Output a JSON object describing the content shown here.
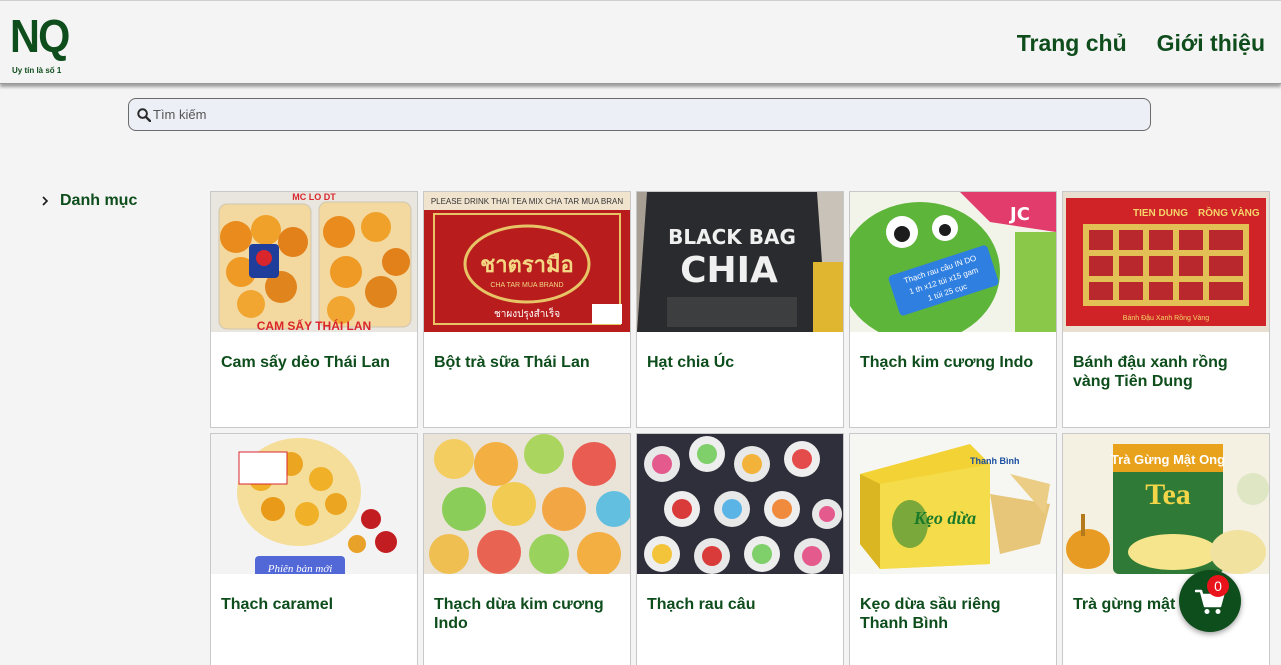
{
  "header": {
    "logo_text": "NQ",
    "logo_tagline": "Uy tín là số 1",
    "nav": [
      {
        "label": "Trang chủ"
      },
      {
        "label": "Giới thiệu"
      }
    ]
  },
  "search": {
    "placeholder": "Tìm kiếm",
    "value": ""
  },
  "sidebar": {
    "category_label": "Danh mục"
  },
  "products": [
    {
      "name": "Cam sấy dẻo Thái Lan",
      "image_text": "CAM SẤY THÁI LAN"
    },
    {
      "name": "Bột trà sữa Thái Lan",
      "image_text": "PLEASE DRINK THAI TEA MIX CHA TAR MUA BRAND"
    },
    {
      "name": "Hạt chia Úc",
      "image_text": "BLACK BAG CHIA"
    },
    {
      "name": "Thạch kim cương Indo",
      "image_text": "Thạch rau câu IN DO 1 th x12 túi x15 gam 1 túi 25 cục"
    },
    {
      "name": "Bánh đậu xanh rồng vàng Tiên Dung",
      "image_text": "TIEN DUNG RỒNG VÀNG"
    },
    {
      "name": "Thạch caramel",
      "image_text": "Phiên bản mới"
    },
    {
      "name": "Thạch dừa kim cương Indo",
      "image_text": ""
    },
    {
      "name": "Thạch rau câu",
      "image_text": ""
    },
    {
      "name": "Kẹo dừa sầu riêng Thanh Bình",
      "image_text": "Thanh Bình Kẹo dừa"
    },
    {
      "name": "Trà gừng mật ong",
      "image_text": "Trà Gừng Mật Ong Tea"
    }
  ],
  "cart": {
    "count": "0"
  },
  "colors": {
    "brand_green": "#0e4d1c",
    "badge_red": "#e8131b",
    "background": "#f4f4f4"
  }
}
